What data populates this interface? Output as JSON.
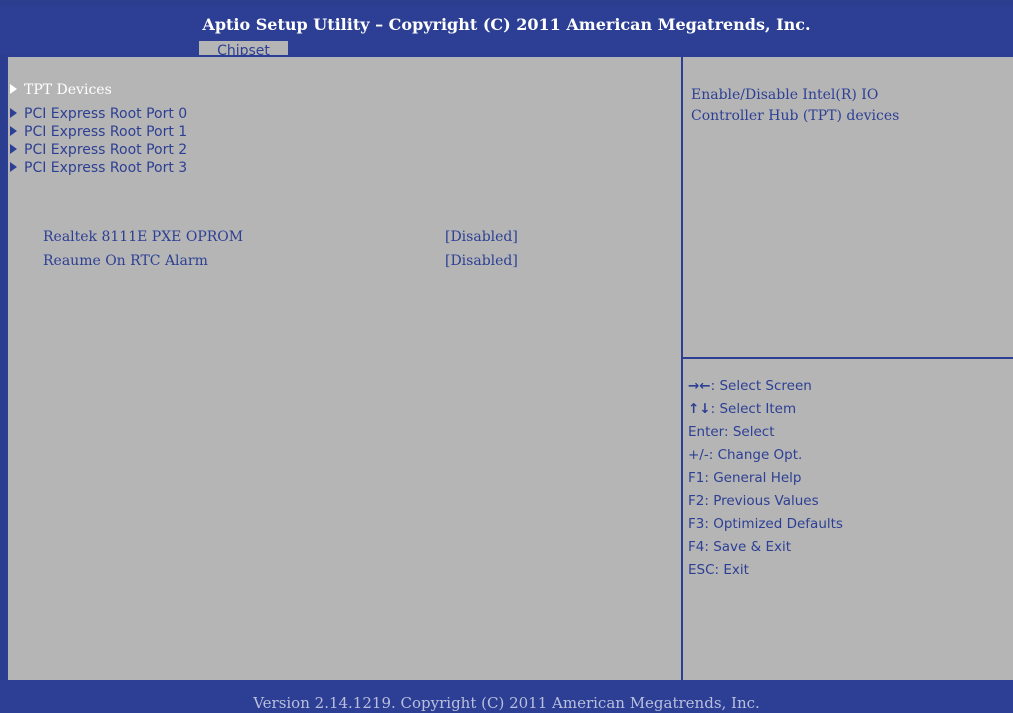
{
  "header": {
    "title": "Aptio Setup Utility – Copyright (C) 2011 American Megatrends, Inc.",
    "active_tab": "Chipset"
  },
  "menu": {
    "items": [
      {
        "label": "TPT Devices",
        "selected": true
      },
      {
        "label": "PCI Express Root Port 0",
        "selected": false
      },
      {
        "label": "PCI Express Root Port 1",
        "selected": false
      },
      {
        "label": "PCI Express Root Port 2",
        "selected": false
      },
      {
        "label": "PCI Express Root Port 3",
        "selected": false
      }
    ],
    "settings": [
      {
        "label": "Realtek 8111E PXE OPROM",
        "value": "[Disabled]"
      },
      {
        "label": "Reaume On RTC Alarm",
        "value": "[Disabled]"
      }
    ]
  },
  "help": {
    "line1": "Enable/Disable Intel(R) IO",
    "line2": "Controller Hub (TPT) devices"
  },
  "keys": [
    {
      "key": "→←",
      "desc": ": Select Screen"
    },
    {
      "key": "↑↓",
      "desc": ": Select Item"
    },
    {
      "key": "",
      "desc": "Enter: Select"
    },
    {
      "key": "",
      "desc": "+/-: Change Opt."
    },
    {
      "key": "",
      "desc": "F1: General Help"
    },
    {
      "key": "",
      "desc": "F2: Previous Values"
    },
    {
      "key": "",
      "desc": "F3: Optimized Defaults"
    },
    {
      "key": "",
      "desc": "F4: Save & Exit"
    },
    {
      "key": "",
      "desc": "ESC: Exit"
    }
  ],
  "footer": {
    "text": "Version 2.14.1219. Copyright (C) 2011 American Megatrends, Inc."
  },
  "colors": {
    "bios_blue": "#2d3f94",
    "bios_grey": "#b5b5b5",
    "selected_text": "#ffffff"
  }
}
